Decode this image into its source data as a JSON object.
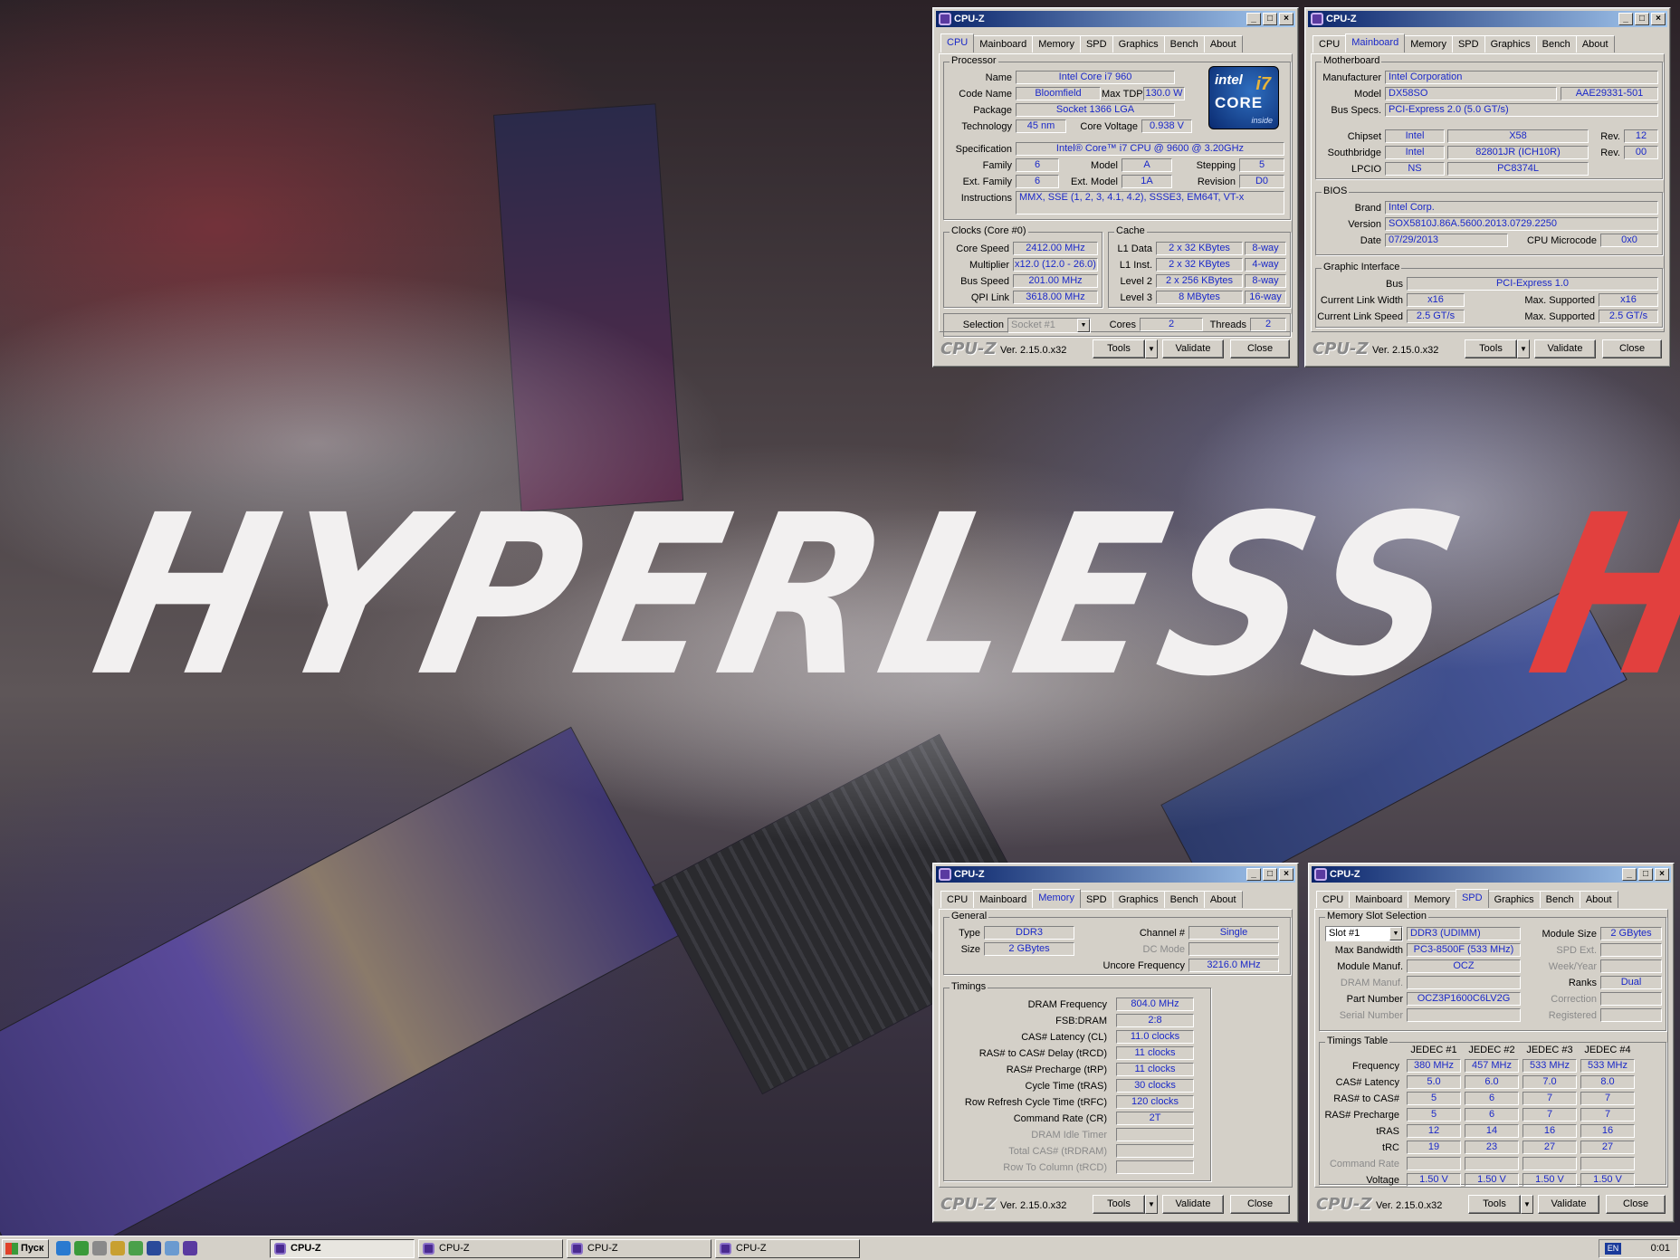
{
  "wallpaper": {
    "word1": "HYPERLESS",
    "word2": "HAVOC"
  },
  "app": {
    "title": "CPU-Z",
    "logo": "CPU-Z",
    "version": "Ver. 2.15.0.x32",
    "tools": "Tools",
    "validate": "Validate",
    "close": "Close"
  },
  "tabs": [
    "CPU",
    "Mainboard",
    "Memory",
    "SPD",
    "Graphics",
    "Bench",
    "About"
  ],
  "cpu": {
    "processor_group": "Processor",
    "name_label": "Name",
    "name": "Intel Core i7 960",
    "codename_label": "Code Name",
    "codename": "Bloomfield",
    "maxtdp_label": "Max TDP",
    "maxtdp": "130.0 W",
    "package_label": "Package",
    "package": "Socket 1366 LGA",
    "tech_label": "Technology",
    "tech": "45 nm",
    "voltage_label": "Core Voltage",
    "voltage": "0.938 V",
    "spec_label": "Specification",
    "spec": "Intel® Core™ i7 CPU       @ 9600 @ 3.20GHz",
    "family_label": "Family",
    "family": "6",
    "model_label": "Model",
    "model": "A",
    "stepping_label": "Stepping",
    "stepping": "5",
    "extfamily_label": "Ext. Family",
    "extfamily": "6",
    "extmodel_label": "Ext. Model",
    "extmodel": "1A",
    "revision_label": "Revision",
    "revision": "D0",
    "instr_label": "Instructions",
    "instr": "MMX, SSE (1, 2, 3, 4.1, 4.2), SSSE3, EM64T, VT-x",
    "clocks_group": "Clocks (Core #0)",
    "corespeed_label": "Core Speed",
    "corespeed": "2412.00 MHz",
    "mult_label": "Multiplier",
    "mult": "x12.0 (12.0 - 26.0)",
    "bus_label": "Bus Speed",
    "bus": "201.00 MHz",
    "qpi_label": "QPI Link",
    "qpi": "3618.00 MHz",
    "cache_group": "Cache",
    "l1d_label": "L1 Data",
    "l1d": "2 x 32 KBytes",
    "l1d_way": "8-way",
    "l1i_label": "L1 Inst.",
    "l1i": "2 x 32 KBytes",
    "l1i_way": "4-way",
    "l2_label": "Level 2",
    "l2": "2 x 256 KBytes",
    "l2_way": "8-way",
    "l3_label": "Level 3",
    "l3": "8 MBytes",
    "l3_way": "16-way",
    "sel_label": "Selection",
    "sel": "Socket #1",
    "cores_label": "Cores",
    "cores": "2",
    "threads_label": "Threads",
    "threads": "2",
    "badge": {
      "brand": "intel",
      "line": "CORE",
      "gen": "i7",
      "tag": "inside"
    }
  },
  "mb": {
    "group": "Motherboard",
    "manuf_label": "Manufacturer",
    "manuf": "Intel Corporation",
    "model_label": "Model",
    "model": "DX58SO",
    "model_rev": "AAE29331-501",
    "busspecs_label": "Bus Specs.",
    "busspecs": "PCI-Express 2.0 (5.0 GT/s)",
    "chipset_label": "Chipset",
    "chipset": "Intel",
    "chipset_model": "X58",
    "rev_label": "Rev.",
    "chipset_rev": "12",
    "south_label": "Southbridge",
    "south": "Intel",
    "south_model": "82801JR (ICH10R)",
    "south_rev": "00",
    "lpcio_label": "LPCIO",
    "lpcio": "NS",
    "lpcio_model": "PC8374L",
    "bios_group": "BIOS",
    "brand_label": "Brand",
    "brand": "Intel Corp.",
    "version_label": "Version",
    "version": "SOX5810J.86A.5600.2013.0729.2250",
    "date_label": "Date",
    "date": "07/29/2013",
    "microcode_label": "CPU Microcode",
    "microcode": "0x0",
    "gi_group": "Graphic Interface",
    "gbus_label": "Bus",
    "gbus": "PCI-Express 1.0",
    "clw_label": "Current Link Width",
    "clw": "x16",
    "msw_label": "Max. Supported",
    "msw": "x16",
    "cls_label": "Current Link Speed",
    "cls": "2.5 GT/s",
    "mss_label": "Max. Supported",
    "mss": "2.5 GT/s"
  },
  "mem": {
    "general_group": "General",
    "type_label": "Type",
    "type": "DDR3",
    "size_label": "Size",
    "size": "2 GBytes",
    "channel_label": "Channel #",
    "channel": "Single",
    "dcmode_label": "DC Mode",
    "uncore_label": "Uncore Frequency",
    "uncore": "3216.0 MHz",
    "timings_group": "Timings",
    "rows": [
      {
        "label": "DRAM Frequency",
        "value": "804.0 MHz"
      },
      {
        "label": "FSB:DRAM",
        "value": "2:8"
      },
      {
        "label": "CAS# Latency (CL)",
        "value": "11.0 clocks"
      },
      {
        "label": "RAS# to CAS# Delay (tRCD)",
        "value": "11 clocks"
      },
      {
        "label": "RAS# Precharge (tRP)",
        "value": "11 clocks"
      },
      {
        "label": "Cycle Time (tRAS)",
        "value": "30 clocks"
      },
      {
        "label": "Row Refresh Cycle Time (tRFC)",
        "value": "120 clocks"
      },
      {
        "label": "Command Rate (CR)",
        "value": "2T"
      },
      {
        "label": "DRAM Idle Timer",
        "value": ""
      },
      {
        "label": "Total CAS# (tRDRAM)",
        "value": ""
      },
      {
        "label": "Row To Column (tRCD)",
        "value": ""
      }
    ]
  },
  "spd": {
    "group": "Memory Slot Selection",
    "slot": "Slot #1",
    "ddr": "DDR3 (UDIMM)",
    "modsize_label": "Module Size",
    "modsize": "2 GBytes",
    "maxbw_label": "Max Bandwidth",
    "maxbw": "PC3-8500F (533 MHz)",
    "spdext_label": "SPD Ext.",
    "modmanuf_label": "Module Manuf.",
    "modmanuf": "OCZ",
    "weekyear_label": "Week/Year",
    "drammanuf_label": "DRAM Manuf.",
    "ranks_label": "Ranks",
    "ranks": "Dual",
    "part_label": "Part Number",
    "part": "OCZ3P1600C6LV2G",
    "correction_label": "Correction",
    "serial_label": "Serial Number",
    "registered_label": "Registered",
    "tt_group": "Timings Table",
    "cols": [
      "JEDEC #1",
      "JEDEC #2",
      "JEDEC #3",
      "JEDEC #4"
    ],
    "rows": [
      {
        "label": "Frequency",
        "values": [
          "380 MHz",
          "457 MHz",
          "533 MHz",
          "533 MHz"
        ]
      },
      {
        "label": "CAS# Latency",
        "values": [
          "5.0",
          "6.0",
          "7.0",
          "8.0"
        ]
      },
      {
        "label": "RAS# to CAS#",
        "values": [
          "5",
          "6",
          "7",
          "7"
        ]
      },
      {
        "label": "RAS# Precharge",
        "values": [
          "5",
          "6",
          "7",
          "7"
        ]
      },
      {
        "label": "tRAS",
        "values": [
          "12",
          "14",
          "16",
          "16"
        ]
      },
      {
        "label": "tRC",
        "values": [
          "19",
          "23",
          "27",
          "27"
        ]
      },
      {
        "label": "Command Rate",
        "values": [
          "",
          "",
          "",
          ""
        ]
      },
      {
        "label": "Voltage",
        "values": [
          "1.50 V",
          "1.50 V",
          "1.50 V",
          "1.50 V"
        ]
      }
    ]
  },
  "taskbar": {
    "start": "Пуск",
    "tasks": [
      "CPU-Z",
      "CPU-Z",
      "CPU-Z",
      "CPU-Z"
    ],
    "lang": "EN",
    "clock": "0:01"
  }
}
